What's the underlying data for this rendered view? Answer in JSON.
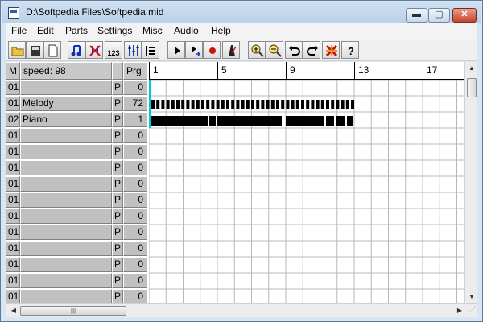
{
  "window": {
    "title": "D:\\Softpedia Files\\Softpedia.mid",
    "min_glyph": "▬",
    "max_glyph": "▢",
    "close_glyph": "✕"
  },
  "menu": [
    "File",
    "Edit",
    "Parts",
    "Settings",
    "Misc",
    "Audio",
    "Help"
  ],
  "toolbar": {
    "icons": [
      "open-folder-icon",
      "save-disk-icon",
      "new-document-icon",
      "notes-icon",
      "mute-notes-icon",
      "numbers-123-icon",
      "mixer-bars-icon",
      "tracks-list-icon",
      "play-icon",
      "step-play-icon",
      "record-icon",
      "metronome-icon",
      "zoom-in-icon",
      "zoom-out-icon",
      "undo-icon",
      "redo-icon",
      "tools-icon",
      "help-icon"
    ],
    "numbers_label": "123"
  },
  "header": {
    "m": "M",
    "speed": "speed:  98",
    "prg": "Prg"
  },
  "ruler": {
    "labels": [
      "1",
      "5",
      "9",
      "13",
      "17"
    ]
  },
  "tracks": [
    {
      "ch": "01",
      "name": "",
      "p": "P",
      "prg": "0"
    },
    {
      "ch": "01",
      "name": "Melody",
      "p": "P",
      "prg": "72"
    },
    {
      "ch": "02",
      "name": "Piano",
      "p": "P",
      "prg": "1"
    },
    {
      "ch": "01",
      "name": "",
      "p": "P",
      "prg": "0"
    },
    {
      "ch": "01",
      "name": "",
      "p": "P",
      "prg": "0"
    },
    {
      "ch": "01",
      "name": "",
      "p": "P",
      "prg": "0"
    },
    {
      "ch": "01",
      "name": "",
      "p": "P",
      "prg": "0"
    },
    {
      "ch": "01",
      "name": "",
      "p": "P",
      "prg": "0"
    },
    {
      "ch": "01",
      "name": "",
      "p": "P",
      "prg": "0"
    },
    {
      "ch": "01",
      "name": "",
      "p": "P",
      "prg": "0"
    },
    {
      "ch": "01",
      "name": "",
      "p": "P",
      "prg": "0"
    },
    {
      "ch": "01",
      "name": "",
      "p": "P",
      "prg": "0"
    },
    {
      "ch": "01",
      "name": "",
      "p": "P",
      "prg": "0"
    },
    {
      "ch": "01",
      "name": "",
      "p": "P",
      "prg": "0"
    }
  ],
  "scroll": {
    "h_thumb_grip": "|||",
    "up": "▲",
    "down": "▼",
    "left": "◀",
    "right": "▶"
  }
}
